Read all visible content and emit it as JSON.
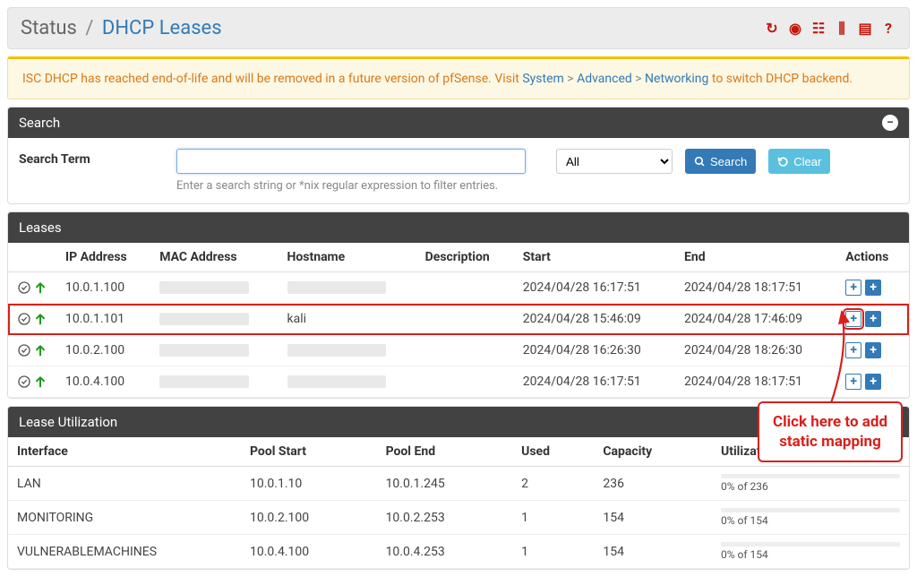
{
  "breadcrumb": {
    "root": "Status",
    "current": "DHCP Leases"
  },
  "alert": {
    "prefix": "ISC DHCP has reached end-of-life and will be removed in a future version of pfSense. Visit ",
    "link1": "System",
    "link2": "Advanced",
    "link3": "Networking",
    "suffix": " to switch DHCP backend."
  },
  "search": {
    "panel_title": "Search",
    "label": "Search Term",
    "placeholder": "",
    "select_value": "All",
    "search_btn": "Search",
    "clear_btn": "Clear",
    "help": "Enter a search string or *nix regular expression to filter entries."
  },
  "leases": {
    "panel_title": "Leases",
    "cols": {
      "ip": "IP Address",
      "mac": "MAC Address",
      "host": "Hostname",
      "desc": "Description",
      "start": "Start",
      "end": "End",
      "actions": "Actions"
    },
    "rows": [
      {
        "ip": "10.0.1.100",
        "host": "",
        "start": "2024/04/28 16:17:51",
        "end": "2024/04/28 18:17:51",
        "highlight": false,
        "red_action": false
      },
      {
        "ip": "10.0.1.101",
        "host": "kali",
        "start": "2024/04/28 15:46:09",
        "end": "2024/04/28 17:46:09",
        "highlight": true,
        "red_action": true
      },
      {
        "ip": "10.0.2.100",
        "host": "",
        "start": "2024/04/28 16:26:30",
        "end": "2024/04/28 18:26:30",
        "highlight": false,
        "red_action": false
      },
      {
        "ip": "10.0.4.100",
        "host": "",
        "start": "2024/04/28 16:17:51",
        "end": "2024/04/28 18:17:51",
        "highlight": false,
        "red_action": false
      }
    ]
  },
  "utilization": {
    "panel_title": "Lease Utilization",
    "cols": {
      "iface": "Interface",
      "pstart": "Pool Start",
      "pend": "Pool End",
      "used": "Used",
      "cap": "Capacity",
      "util": "Utilization"
    },
    "rows": [
      {
        "iface": "LAN",
        "pstart": "10.0.1.10",
        "pend": "10.0.1.245",
        "used": "2",
        "cap": "236",
        "util_text": "0% of 236"
      },
      {
        "iface": "MONITORING",
        "pstart": "10.0.2.100",
        "pend": "10.0.2.253",
        "used": "1",
        "cap": "154",
        "util_text": "0% of 154"
      },
      {
        "iface": "VULNERABLEMACHINES",
        "pstart": "10.0.4.100",
        "pend": "10.0.4.253",
        "used": "1",
        "cap": "154",
        "util_text": "0% of 154"
      }
    ]
  },
  "annotation": {
    "line1": "Click here to add",
    "line2": "static mapping"
  }
}
